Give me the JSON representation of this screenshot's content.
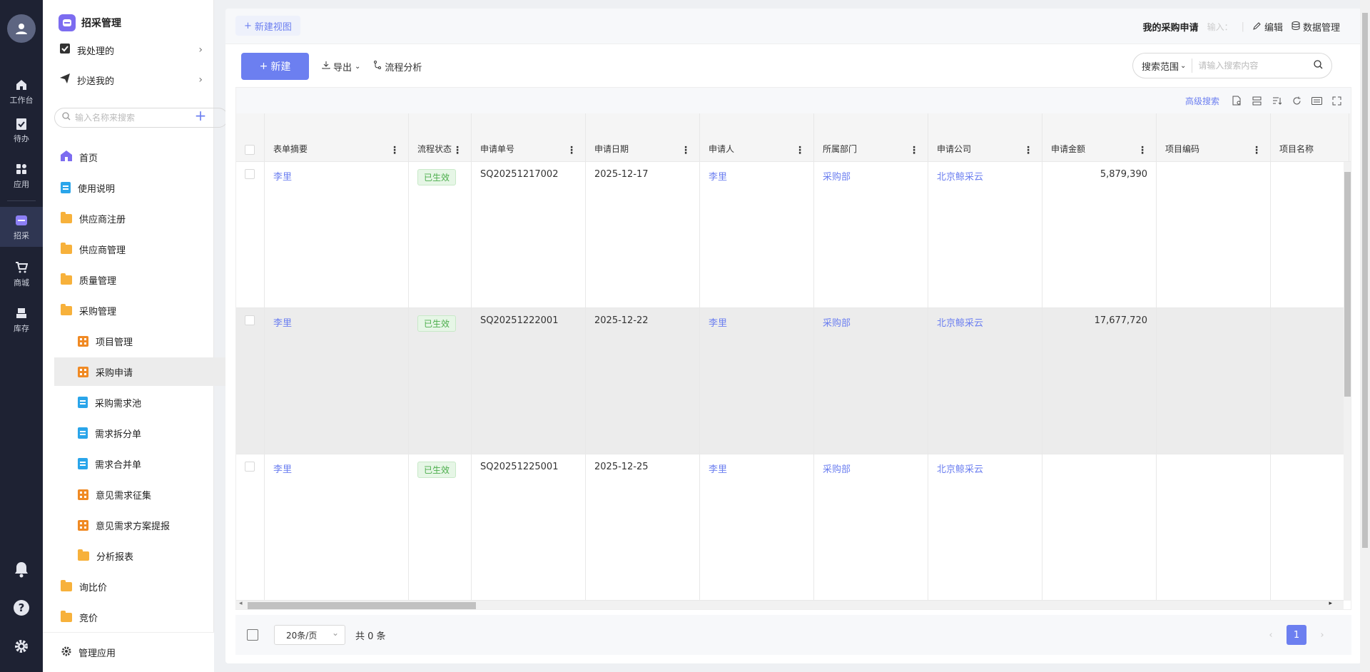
{
  "rail": {
    "items": [
      {
        "label": "工作台",
        "icon": "home-icon"
      },
      {
        "label": "待办",
        "icon": "clipboard-check-icon"
      },
      {
        "label": "应用",
        "icon": "apps-grid-icon"
      },
      {
        "label": "招采",
        "icon": "procurement-icon",
        "active": true
      },
      {
        "label": "商城",
        "icon": "cart-icon"
      },
      {
        "label": "库存",
        "icon": "inventory-icon"
      }
    ]
  },
  "nav": {
    "title": "招采管理",
    "quick": [
      {
        "label": "我处理的",
        "icon": "check-box-icon"
      },
      {
        "label": "抄送我的",
        "icon": "send-icon"
      }
    ],
    "search_placeholder": "输入名称来搜索",
    "items": [
      {
        "label": "首页",
        "icon": "home-icon",
        "type": "home"
      },
      {
        "label": "使用说明",
        "icon": "document-icon",
        "type": "doc"
      },
      {
        "label": "供应商注册",
        "icon": "folder-icon",
        "type": "folder"
      },
      {
        "label": "供应商管理",
        "icon": "folder-icon",
        "type": "folder"
      },
      {
        "label": "质量管理",
        "icon": "folder-icon",
        "type": "folder"
      },
      {
        "label": "采购管理",
        "icon": "folder-open-icon",
        "type": "folder"
      },
      {
        "label": "项目管理",
        "icon": "form-grid-icon",
        "type": "grid",
        "sub": true
      },
      {
        "label": "采购申请",
        "icon": "form-grid-icon",
        "type": "grid",
        "sub": true,
        "active": true
      },
      {
        "label": "采购需求池",
        "icon": "document-icon",
        "type": "doc",
        "sub": true
      },
      {
        "label": "需求拆分单",
        "icon": "document-icon",
        "type": "doc",
        "sub": true
      },
      {
        "label": "需求合并单",
        "icon": "document-icon",
        "type": "doc",
        "sub": true
      },
      {
        "label": "意见需求征集",
        "icon": "form-grid-icon",
        "type": "grid",
        "sub": true
      },
      {
        "label": "意见需求方案提报",
        "icon": "form-grid-icon",
        "type": "grid",
        "sub": true
      },
      {
        "label": "分析报表",
        "icon": "folder-icon",
        "type": "folder",
        "sub": true
      },
      {
        "label": "询比价",
        "icon": "folder-icon",
        "type": "folder"
      },
      {
        "label": "竞价",
        "icon": "folder-icon",
        "type": "folder"
      }
    ],
    "footer": "管理应用"
  },
  "topbar": {
    "new_view": "新建视图",
    "view_title": "我的采购申请",
    "input_hint": "输入：",
    "edit": "编辑",
    "data_manage": "数据管理"
  },
  "toolbar": {
    "new": "新建",
    "export": "导出",
    "flow": "流程分析",
    "search_scope": "搜索范围",
    "search_placeholder": "请输入搜索内容",
    "advanced": "高级搜索"
  },
  "table": {
    "columns": [
      "表单摘要",
      "流程状态",
      "申请单号",
      "申请日期",
      "申请人",
      "所属部门",
      "申请公司",
      "申请金额",
      "项目编码",
      "项目名称"
    ],
    "rows": [
      {
        "summary": "李里",
        "status": "已生效",
        "no": "SQ20251217002",
        "date": "2025-12-17",
        "applicant": "李里",
        "dept": "采购部",
        "company": "北京鲸采云",
        "amount": "5,879,390",
        "code": "",
        "name": ""
      },
      {
        "summary": "李里",
        "status": "已生效",
        "no": "SQ20251222001",
        "date": "2025-12-22",
        "applicant": "李里",
        "dept": "采购部",
        "company": "北京鲸采云",
        "amount": "17,677,720",
        "code": "",
        "name": ""
      },
      {
        "summary": "李里",
        "status": "已生效",
        "no": "SQ20251225001",
        "date": "2025-12-25",
        "applicant": "李里",
        "dept": "采购部",
        "company": "北京鲸采云",
        "amount": "",
        "code": "",
        "name": ""
      }
    ]
  },
  "pager": {
    "page_size": "20条/页",
    "total": "共 0 条",
    "current": "1"
  },
  "colors": {
    "accent": "#6c7ff0",
    "rail_bg": "#1e2233",
    "status_green": "#4cae4c"
  }
}
